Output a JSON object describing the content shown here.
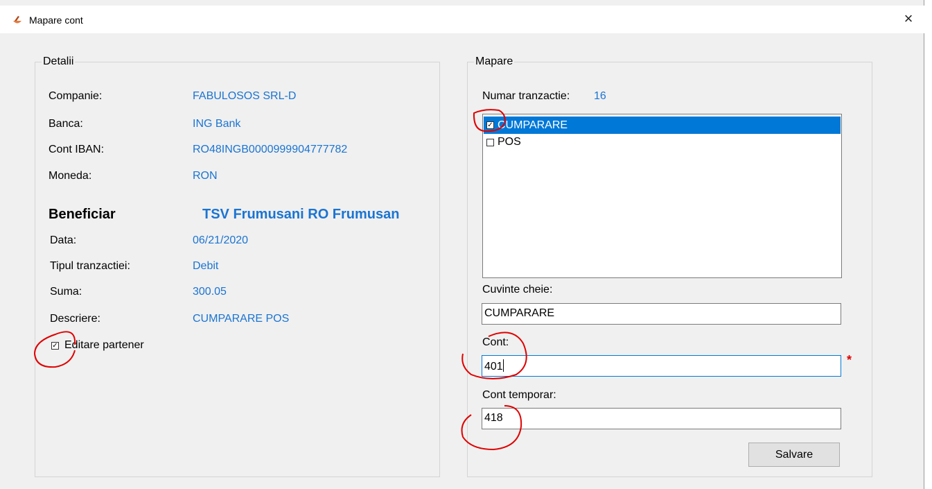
{
  "window": {
    "title": "Mapare cont",
    "close_glyph": "×"
  },
  "details": {
    "legend": "Detalii",
    "companie_label": "Companie:",
    "companie_value": "FABULOSOS SRL-D",
    "banca_label": "Banca:",
    "banca_value": "ING Bank",
    "iban_label": "Cont IBAN:",
    "iban_value": "RO48INGB0000999904777782",
    "moneda_label": "Moneda:",
    "moneda_value": "RON",
    "beneficiar_label": "Beneficiar",
    "beneficiar_value": "TSV Frumusani RO Frumusan",
    "data_label": "Data:",
    "data_value": "06/21/2020",
    "tip_label": "Tipul tranzactiei:",
    "tip_value": "Debit",
    "suma_label": "Suma:",
    "suma_value": "300.05",
    "descriere_label": "Descriere:",
    "descriere_value": "CUMPARARE POS",
    "editare_label": "Editare partener",
    "editare_checked": true
  },
  "mapare": {
    "legend": "Mapare",
    "numar_label": "Numar tranzactie:",
    "numar_value": "16",
    "list_items": [
      {
        "label": "CUMPARARE",
        "checked": true,
        "selected": true
      },
      {
        "label": "POS",
        "checked": false,
        "selected": false
      }
    ],
    "cuvinte_label": "Cuvinte cheie:",
    "cuvinte_value": "CUMPARARE",
    "cont_label": "Cont:",
    "cont_value": "401",
    "cont_required_mark": "*",
    "cont_temp_label": "Cont temporar:",
    "cont_temp_value": "418",
    "save_label": "Salvare"
  },
  "colors": {
    "value_text": "#1a74d2",
    "selection": "#0078d7",
    "annotation": "#e00000",
    "window_bg": "#f0f0f0"
  }
}
